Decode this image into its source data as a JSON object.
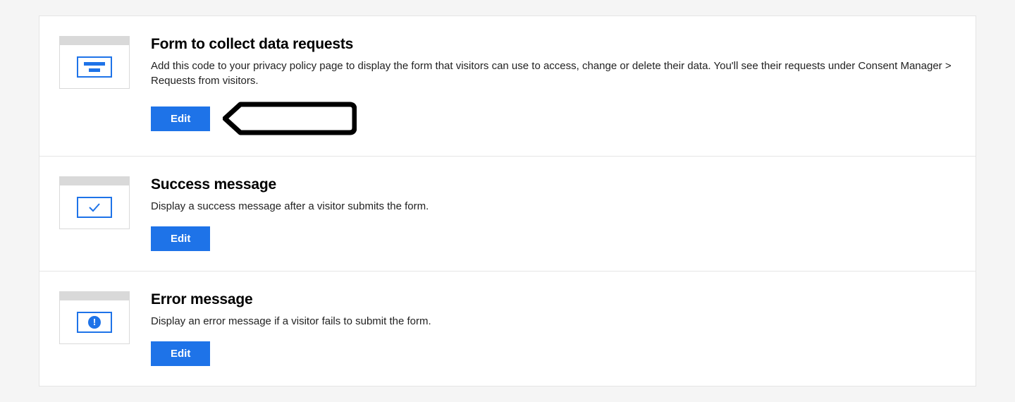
{
  "sections": [
    {
      "title": "Form to collect data requests",
      "description": "Add this code to your privacy policy page to display the form that visitors can use to access, change or delete their data. You'll see their requests under Consent Manager > Requests from visitors.",
      "button_label": "Edit"
    },
    {
      "title": "Success message",
      "description": "Display a success message after a visitor submits the form.",
      "button_label": "Edit"
    },
    {
      "title": "Error message",
      "description": "Display an error message if a visitor fails to submit the form.",
      "button_label": "Edit"
    }
  ]
}
